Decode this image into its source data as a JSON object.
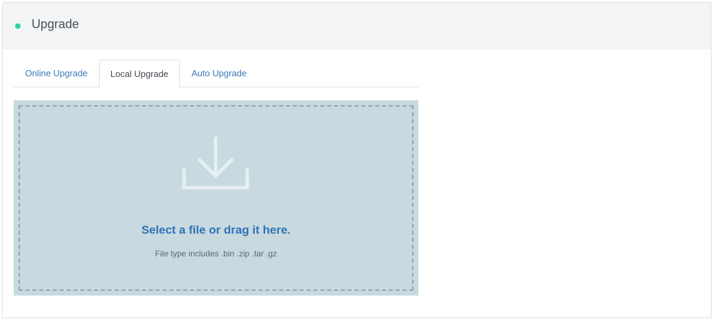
{
  "panel": {
    "title": "Upgrade",
    "status_color": "#2bd4a0"
  },
  "tabs": [
    {
      "label": "Online Upgrade",
      "active": false
    },
    {
      "label": "Local Upgrade",
      "active": true
    },
    {
      "label": "Auto Upgrade",
      "active": false
    }
  ],
  "dropzone": {
    "icon": "download-tray-icon",
    "title": "Select a file or drag it here.",
    "hint": "File type includes .bin .zip .tar .gz"
  },
  "colors": {
    "accent": "#2f73b8",
    "dropzone_bg": "#c8d9df"
  }
}
